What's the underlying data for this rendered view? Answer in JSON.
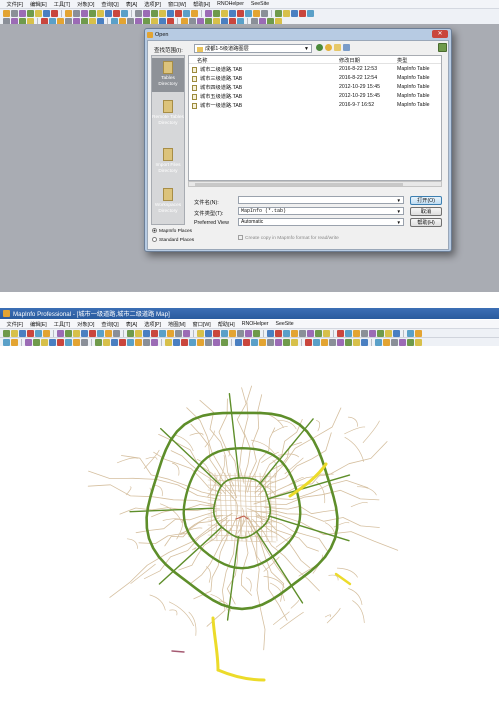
{
  "top": {
    "menu": [
      "文件[F]",
      "编辑[E]",
      "工具[T]",
      "对象[O]",
      "查询[Q]",
      "表[A]",
      "选项[P]",
      "窗口[W]",
      "帮助[H]",
      "RNOHelper",
      "SeeSite"
    ]
  },
  "dialog": {
    "title": "Open",
    "close_glyph": "✕",
    "look_in_label": "查找范围(I):",
    "look_in_value": "成都1-5级道路图层",
    "places": [
      "Tables Directory",
      "Remote Tables Directory",
      "Import Files Directory",
      "Workspaces Directory"
    ],
    "columns": [
      "名称",
      "修改日期",
      "类型"
    ],
    "files": [
      {
        "name": "城市二级道路.TAB",
        "date": "2016-8-22 12:53",
        "type": "MapInfo Table"
      },
      {
        "name": "城市三级道路.TAB",
        "date": "2016-8-22 12:54",
        "type": "MapInfo Table"
      },
      {
        "name": "城市四级道路.TAB",
        "date": "2012-10-29 15:45",
        "type": "MapInfo Table"
      },
      {
        "name": "城市五级道路.TAB",
        "date": "2012-10-29 15:45",
        "type": "MapInfo Table"
      },
      {
        "name": "城市一级道路.TAB",
        "date": "2016-9-7 16:52",
        "type": "MapInfo Table"
      }
    ],
    "filename_label": "文件名(N):",
    "filename_value": "",
    "filetype_label": "文件类型(T):",
    "filetype_value": "MapInfo (*.tab)",
    "preferred_view_label": "Preferred View",
    "preferred_view_value": "Automatic",
    "open_button": "打开(O)",
    "cancel_button": "取消",
    "help_button": "帮助(H)",
    "copy_checkbox": "Create copy in MapInfo format for read/write",
    "radio_mapinfo": "MapInfo Places",
    "radio_standard": "Standard Places"
  },
  "bottom": {
    "window_title": "MapInfo Professional - [城市一级道路,城市二级道路 Map]",
    "menu": [
      "文件[F]",
      "编辑[E]",
      "工具[T]",
      "对象[O]",
      "查询[Q]",
      "表[A]",
      "选项[P]",
      "地图[M]",
      "窗口[W]",
      "帮助[H]",
      "RNOHelper",
      "SeeSite"
    ]
  },
  "colors": {
    "ring_road": "#5e8e2a",
    "minor_road": "#d5bf9f",
    "highlight_road": "#ecdb2a",
    "dialog_frame": "#b7cbe3",
    "title_bar": "#2f62a8"
  }
}
